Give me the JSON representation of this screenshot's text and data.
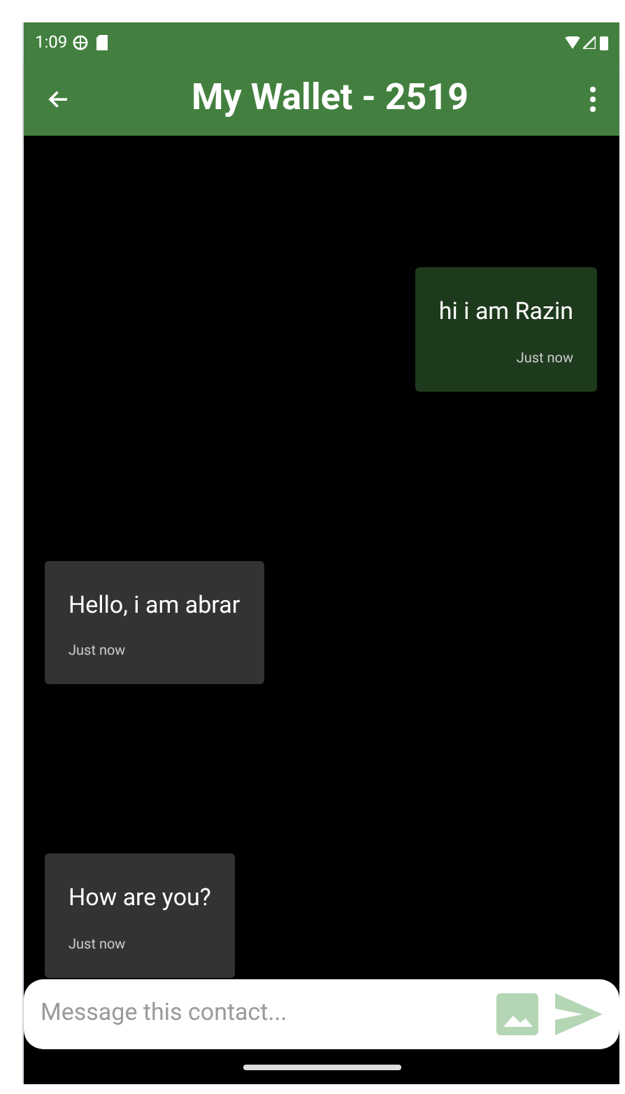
{
  "status_bar": {
    "time": "1:09"
  },
  "app_bar": {
    "title": "My Wallet - 2519"
  },
  "messages": [
    {
      "kind": "outgoing",
      "text": "hi i am Razin",
      "time": "Just now"
    },
    {
      "kind": "incoming",
      "text": "Hello, i am abrar",
      "time": "Just now"
    },
    {
      "kind": "incoming",
      "text": "How are you?",
      "time": "Just now"
    }
  ],
  "composer": {
    "placeholder": "Message this contact..."
  }
}
